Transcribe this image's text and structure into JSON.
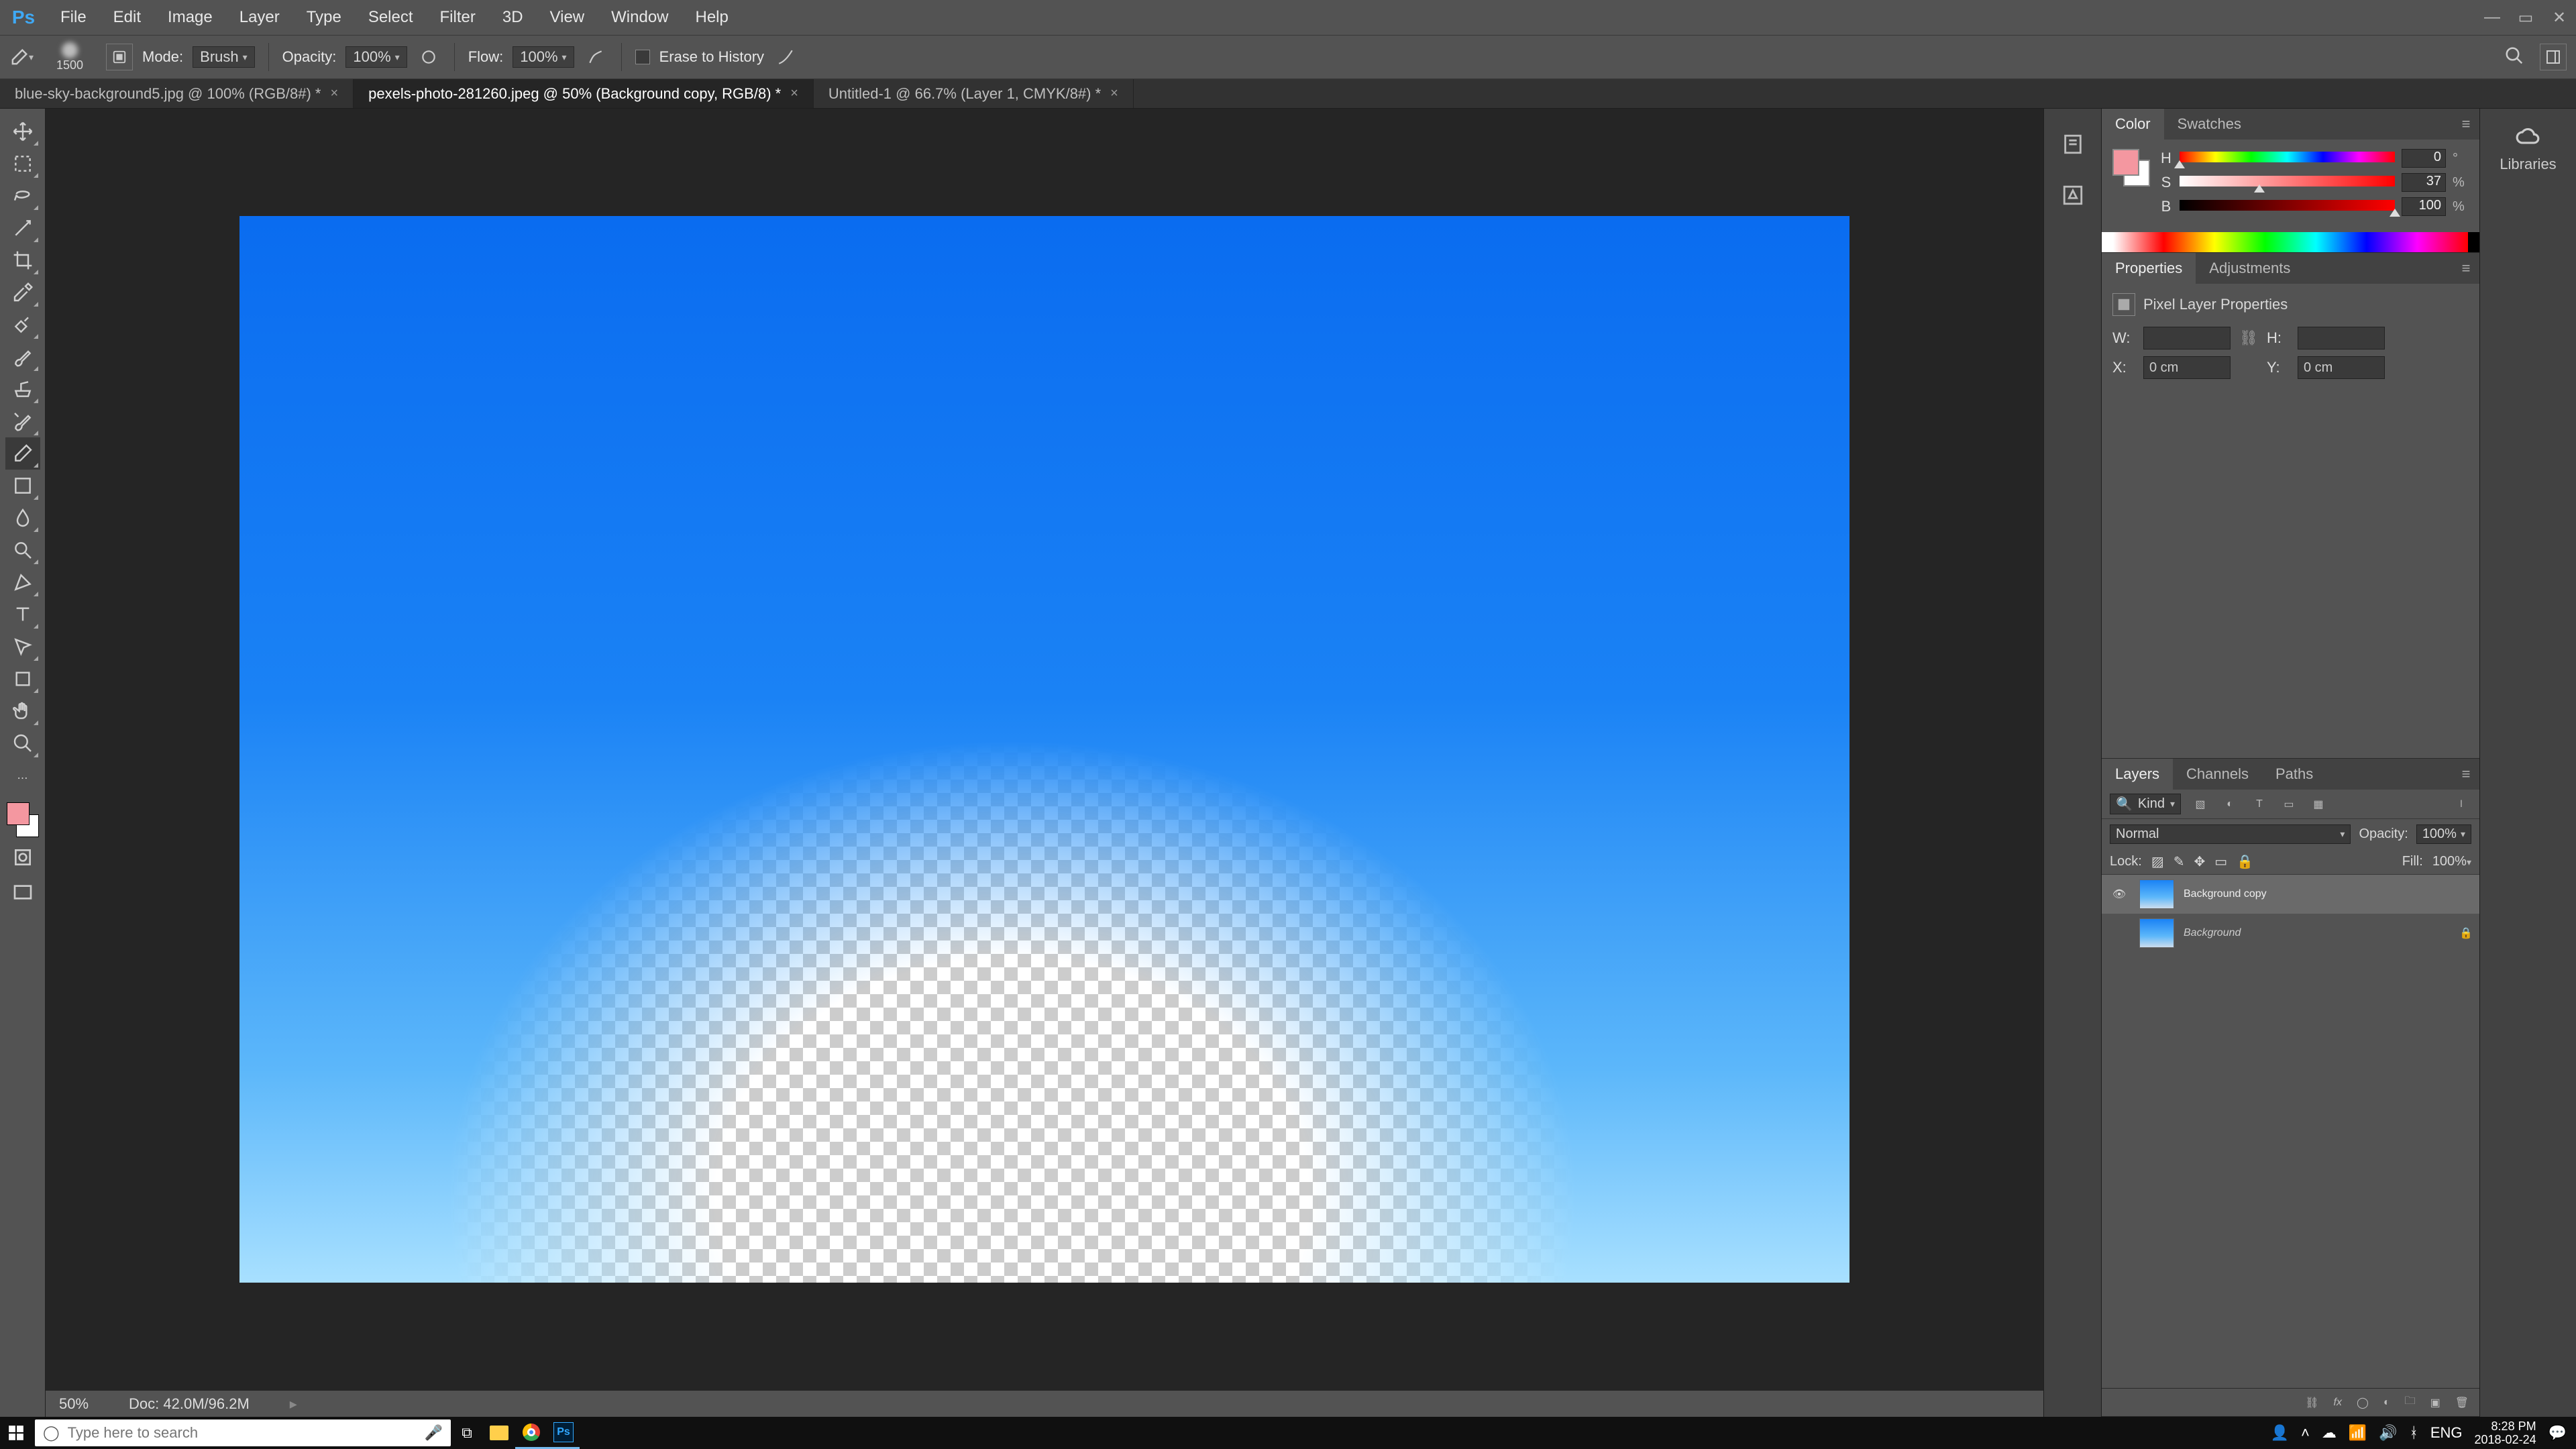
{
  "menubar": {
    "logo": "Ps",
    "items": [
      "File",
      "Edit",
      "Image",
      "Layer",
      "Type",
      "Select",
      "Filter",
      "3D",
      "View",
      "Window",
      "Help"
    ]
  },
  "optionsbar": {
    "brush_size": "1500",
    "mode_label": "Mode:",
    "mode_value": "Brush",
    "opacity_label": "Opacity:",
    "opacity_value": "100%",
    "flow_label": "Flow:",
    "flow_value": "100%",
    "erase_history_label": "Erase to History"
  },
  "doc_tabs": [
    {
      "label": "blue-sky-background5.jpg @ 100% (RGB/8#) *",
      "active": false
    },
    {
      "label": "pexels-photo-281260.jpeg @ 50% (Background copy, RGB/8) *",
      "active": true
    },
    {
      "label": "Untitled-1 @ 66.7% (Layer 1, CMYK/8#) *",
      "active": false
    }
  ],
  "tools": [
    {
      "name": "move-tool"
    },
    {
      "name": "marquee-tool"
    },
    {
      "name": "lasso-tool"
    },
    {
      "name": "magic-wand-tool"
    },
    {
      "name": "crop-tool"
    },
    {
      "name": "eyedropper-tool"
    },
    {
      "name": "healing-brush-tool"
    },
    {
      "name": "brush-tool"
    },
    {
      "name": "clone-stamp-tool"
    },
    {
      "name": "history-brush-tool"
    },
    {
      "name": "eraser-tool",
      "active": true
    },
    {
      "name": "gradient-tool"
    },
    {
      "name": "blur-tool"
    },
    {
      "name": "dodge-tool"
    },
    {
      "name": "pen-tool"
    },
    {
      "name": "type-tool"
    },
    {
      "name": "path-selection-tool"
    },
    {
      "name": "shape-tool"
    },
    {
      "name": "hand-tool"
    },
    {
      "name": "zoom-tool"
    }
  ],
  "statusbar": {
    "zoom": "50%",
    "doc": "Doc: 42.0M/96.2M"
  },
  "color_panel": {
    "tabs": [
      "Color",
      "Swatches"
    ],
    "channels": [
      {
        "label": "H",
        "value": "0",
        "unit": "°",
        "pos": 0
      },
      {
        "label": "S",
        "value": "37",
        "unit": "%",
        "pos": 37
      },
      {
        "label": "B",
        "value": "100",
        "unit": "%",
        "pos": 100
      }
    ],
    "fg": "#f497a0",
    "bg": "#ffffff"
  },
  "properties_panel": {
    "tabs": [
      "Properties",
      "Adjustments"
    ],
    "subtitle": "Pixel Layer Properties",
    "fields": {
      "W_label": "W:",
      "W": "",
      "H_label": "H:",
      "H": "",
      "X_label": "X:",
      "X": "0 cm",
      "Y_label": "Y:",
      "Y": "0 cm"
    }
  },
  "layers_panel": {
    "tabs": [
      "Layers",
      "Channels",
      "Paths"
    ],
    "filter_label": "Kind",
    "blend_mode": "Normal",
    "opacity_label": "Opacity:",
    "opacity_value": "100%",
    "lock_label": "Lock:",
    "fill_label": "Fill:",
    "fill_value": "100%",
    "layers": [
      {
        "name": "Background copy",
        "visible": true,
        "selected": true,
        "locked": false,
        "bg": false
      },
      {
        "name": "Background",
        "visible": false,
        "selected": false,
        "locked": true,
        "bg": true
      }
    ]
  },
  "libraries_label": "Libraries",
  "taskbar": {
    "search_placeholder": "Type here to search",
    "lang": "ENG",
    "time": "8:28 PM",
    "date": "2018-02-24"
  }
}
